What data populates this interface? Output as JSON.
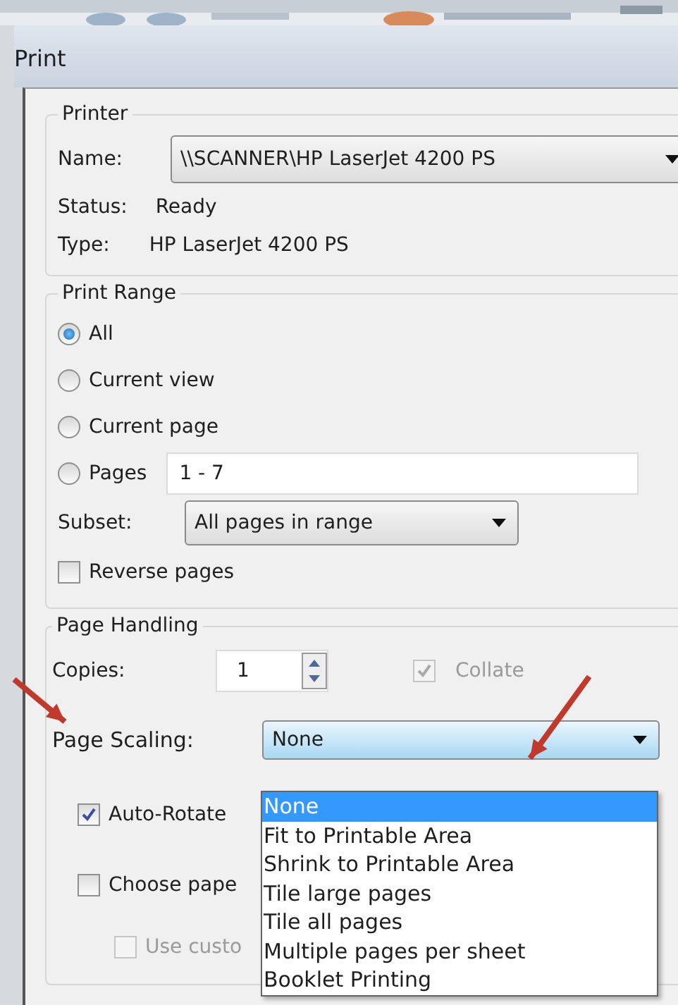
{
  "window": {
    "title": "Print"
  },
  "printer": {
    "legend": "Printer",
    "name_label": "Name:",
    "name_value": "\\\\SCANNER\\HP LaserJet 4200 PS",
    "status_label": "Status:",
    "status": "Ready",
    "type_label": "Type:",
    "type": "HP LaserJet 4200 PS"
  },
  "print_range": {
    "legend": "Print Range",
    "options": [
      {
        "label": "All",
        "selected": true
      },
      {
        "label": "Current view",
        "selected": false
      },
      {
        "label": "Current page",
        "selected": false
      },
      {
        "label": "Pages",
        "selected": false
      }
    ],
    "pages_value": "1 - 7",
    "subset_label": "Subset:",
    "subset_value": "All pages in range",
    "reverse": {
      "label": "Reverse pages",
      "checked": false
    }
  },
  "page_handling": {
    "legend": "Page Handling",
    "copies_label": "Copies:",
    "copies": "1",
    "collate": {
      "label": "Collate",
      "checked": true,
      "disabled": true
    },
    "scaling_label": "Page Scaling:",
    "scaling_value": "None",
    "scaling_options": [
      {
        "label": "None",
        "selected": true
      },
      {
        "label": "Fit to Printable Area",
        "selected": false
      },
      {
        "label": "Shrink to Printable Area",
        "selected": false
      },
      {
        "label": "Tile large pages",
        "selected": false
      },
      {
        "label": "Tile all pages",
        "selected": false
      },
      {
        "label": "Multiple pages per sheet",
        "selected": false
      },
      {
        "label": "Booklet Printing",
        "selected": false
      }
    ],
    "auto_rotate": {
      "label": "Auto-Rotate",
      "checked": true,
      "disabled": false
    },
    "choose_paper": {
      "label": "Choose pape",
      "checked": false,
      "disabled": false
    },
    "custom": {
      "label": "Use custo",
      "checked": false,
      "disabled": true
    }
  }
}
